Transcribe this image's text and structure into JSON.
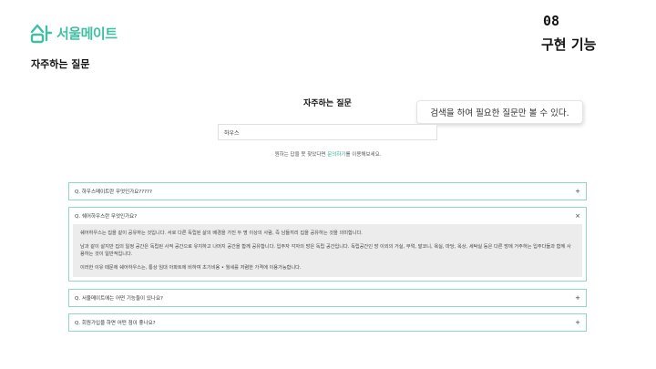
{
  "logo": {
    "text": "서울메이트"
  },
  "section_title": "자주하는 질문",
  "slide": {
    "number": "08",
    "heading": "구현 기능"
  },
  "screen": {
    "title": "자주하는 질문",
    "callout": "검색을 하여 필요한 질문만 볼 수 있다.",
    "search": {
      "value": "하우스",
      "placeholder": ""
    },
    "hint": {
      "before": "원하는 답을 못 찾았다면 ",
      "link": "문의하기",
      "after": "를 이용해보세요."
    },
    "faqs": [
      {
        "question": "Q. 하우스메이트란 무엇인가요?????",
        "toggle": "+"
      },
      {
        "question": "Q. 쉐어하우스란 무엇인가요?",
        "toggle": "×",
        "answer": [
          "쉐어하우스는 집을 같이 공유하는 것입니다. 서로 다른 독립된 삶의 배경을 가진 두 명 이상의 사람, 즉 남들끼리 집을 공유하는 것을 의미합니다.",
          "남과 같이 살지만 집의 일정 공간은 독립된 사적 공간으로 유지하고 나머지 공간을 함께 공유합니다. 입주자 각자의 방은 독립 공간입니다. 독립공간인 방 이외의 거실, 부엌, 발코니, 욕실, 마당, 옥상, 세탁실 등은 다른 방에 거주하는 입주다들과 함께 사용하는 것이 일반적입니다.",
          "이러한 이유 때문에 쉐어하우스는, 통상 임대 아파트에 비하여 초기비용 • 월세를 저렴한 가격에 이용가능합니다."
        ]
      },
      {
        "question": "Q. 서울메이트에는 어떤 기능들이 있나요?",
        "toggle": "+"
      },
      {
        "question": "Q. 회원가입을 하면 어떤 점이 좋나요?",
        "toggle": "+"
      }
    ]
  },
  "colors": {
    "accent": "#3fbfa3",
    "highlight": "#fff23a",
    "border": "#8fd8c8"
  },
  "icons": {
    "logo": "house-logo-icon"
  }
}
